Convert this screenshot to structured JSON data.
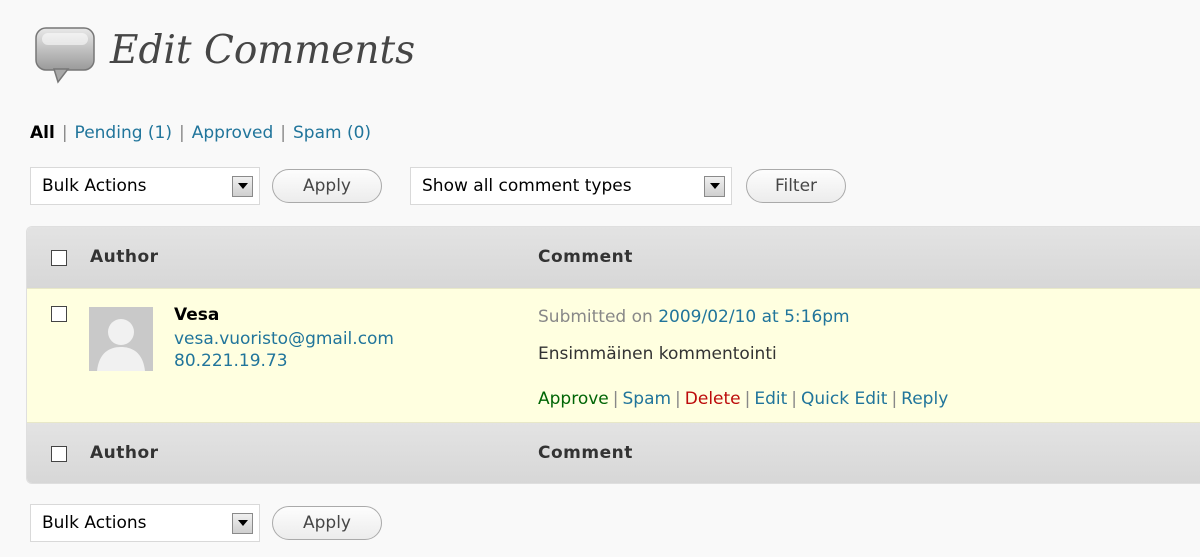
{
  "page": {
    "title": "Edit Comments",
    "icon": "comments-icon"
  },
  "filters": {
    "all": "All",
    "pending": "Pending (1)",
    "approved": "Approved",
    "spam": "Spam (0)",
    "separator": "|"
  },
  "top_nav": {
    "bulk_actions": "Bulk Actions",
    "apply": "Apply",
    "comment_types": "Show all comment types",
    "filter": "Filter"
  },
  "table": {
    "columns": [
      "Author",
      "Comment"
    ],
    "rows": [
      {
        "author_name": "Vesa",
        "author_email": "vesa.vuoristo@gmail.com",
        "author_ip": "80.221.19.73",
        "submitted_prefix": "Submitted on ",
        "submitted_date": "2009/02/10 at 5:16pm",
        "comment": "Ensimmäinen kommentointi",
        "actions": {
          "approve": "Approve",
          "spam": "Spam",
          "delete": "Delete",
          "edit": "Edit",
          "quick_edit": "Quick Edit",
          "reply": "Reply",
          "separator": "|"
        }
      }
    ]
  },
  "bottom_nav": {
    "bulk_actions": "Bulk Actions",
    "apply": "Apply"
  },
  "colors": {
    "link": "#21759b",
    "approve": "#006505",
    "delete": "#bc0b0b",
    "unapproved_row": "#ffffe0"
  }
}
